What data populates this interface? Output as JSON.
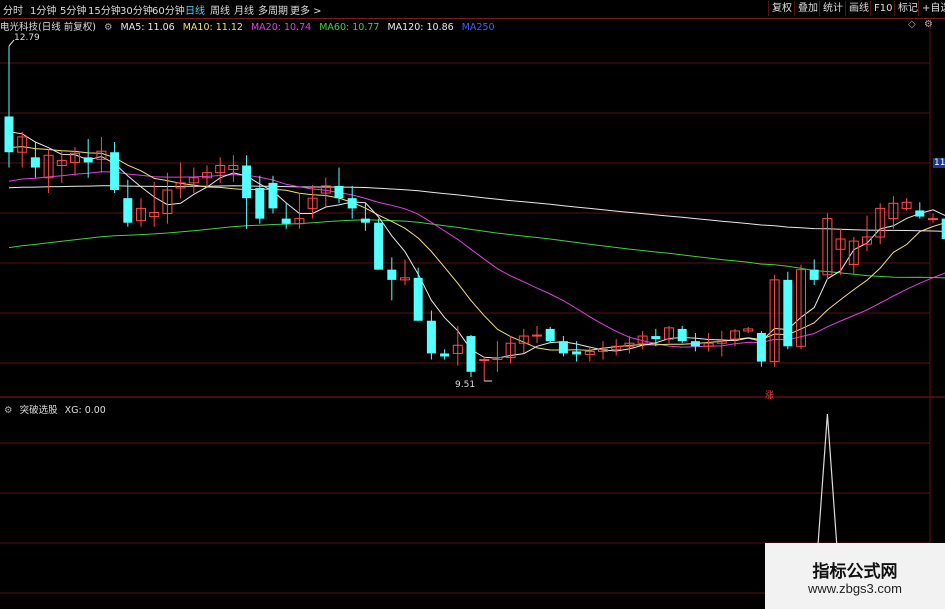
{
  "toolbar": {
    "timeframes": [
      "分时",
      "1分钟",
      "5分钟",
      "15分钟",
      "30分钟",
      "60分钟",
      "日线",
      "周线",
      "月线",
      "多周期",
      "更多 >"
    ],
    "active": "日线",
    "buttons": [
      "复权",
      "叠加",
      "统计",
      "画线",
      "F10",
      "标记",
      "+自选"
    ]
  },
  "info": {
    "title": "电光科技(日线 前复权)",
    "ma": [
      {
        "label": "MA5: 11.06",
        "color": "#e8e8e8"
      },
      {
        "label": "MA10: 11.12",
        "color": "#f0e070"
      },
      {
        "label": "MA20: 10.74",
        "color": "#e040e0"
      },
      {
        "label": "MA60: 10.77",
        "color": "#40d040"
      },
      {
        "label": "MA120: 10.86",
        "color": "#e8e8e8"
      },
      {
        "label": "MA250",
        "color": "#4060ff"
      }
    ]
  },
  "annotations": {
    "high": "12.79",
    "low": "9.51",
    "right_axis": "11",
    "zhang": "涨"
  },
  "indicator": {
    "name": "突破选股",
    "value": "XG: 0.00"
  },
  "watermark": {
    "title": "指标公式网",
    "url": "www.zbgs3.com"
  },
  "colors": {
    "up": "#ff4a4a",
    "down": "#54ffff",
    "grid": "#5a0f0f",
    "ma5": "#e8e8e8",
    "ma10": "#f0e070",
    "ma20": "#e040e0",
    "ma60": "#40d040",
    "ma120": "#e8e8e8"
  },
  "chart_data": {
    "type": "candlestick",
    "price_range": [
      9.51,
      12.79
    ],
    "candles": [
      [
        12.1,
        12.79,
        11.6,
        11.75
      ],
      [
        11.75,
        11.95,
        11.6,
        11.9
      ],
      [
        11.7,
        11.85,
        11.5,
        11.6
      ],
      [
        11.5,
        11.78,
        11.35,
        11.72
      ],
      [
        11.62,
        11.76,
        11.45,
        11.67
      ],
      [
        11.65,
        11.8,
        11.52,
        11.74
      ],
      [
        11.7,
        11.88,
        11.5,
        11.65
      ],
      [
        11.68,
        11.9,
        11.55,
        11.76
      ],
      [
        11.75,
        11.85,
        11.35,
        11.38
      ],
      [
        11.3,
        11.48,
        11.02,
        11.06
      ],
      [
        11.08,
        11.3,
        11.02,
        11.2
      ],
      [
        11.12,
        11.46,
        11.02,
        11.16
      ],
      [
        11.15,
        11.55,
        11.05,
        11.38
      ],
      [
        11.4,
        11.65,
        11.3,
        11.45
      ],
      [
        11.45,
        11.6,
        11.35,
        11.5
      ],
      [
        11.5,
        11.62,
        11.4,
        11.55
      ],
      [
        11.55,
        11.7,
        11.45,
        11.62
      ],
      [
        11.58,
        11.72,
        11.46,
        11.62
      ],
      [
        11.62,
        11.72,
        11.0,
        11.3
      ],
      [
        11.4,
        11.52,
        11.05,
        11.1
      ],
      [
        11.45,
        11.52,
        11.15,
        11.2
      ],
      [
        11.1,
        11.25,
        11.0,
        11.05
      ],
      [
        11.05,
        11.35,
        11.0,
        11.1
      ],
      [
        11.2,
        11.43,
        11.1,
        11.3
      ],
      [
        11.35,
        11.5,
        11.22,
        11.42
      ],
      [
        11.42,
        11.6,
        11.25,
        11.3
      ],
      [
        11.3,
        11.42,
        11.1,
        11.2
      ],
      [
        11.1,
        11.25,
        10.98,
        11.06
      ],
      [
        11.06,
        11.1,
        10.6,
        10.6
      ],
      [
        10.6,
        10.72,
        10.3,
        10.5
      ],
      [
        10.5,
        10.7,
        10.45,
        10.52
      ],
      [
        10.52,
        10.62,
        10.1,
        10.1
      ],
      [
        10.1,
        10.2,
        9.72,
        9.78
      ],
      [
        9.78,
        9.82,
        9.72,
        9.75
      ],
      [
        9.78,
        10.05,
        9.66,
        9.86
      ],
      [
        9.95,
        9.96,
        9.55,
        9.6
      ],
      [
        9.72,
        9.75,
        9.51,
        9.72
      ],
      [
        9.72,
        9.9,
        9.6,
        9.74
      ],
      [
        9.74,
        9.95,
        9.68,
        9.88
      ],
      [
        9.88,
        10.02,
        9.78,
        9.95
      ],
      [
        9.95,
        10.05,
        9.88,
        9.96
      ],
      [
        10.02,
        10.04,
        9.88,
        9.9
      ],
      [
        9.9,
        9.95,
        9.75,
        9.78
      ],
      [
        9.8,
        9.9,
        9.7,
        9.77
      ],
      [
        9.77,
        9.85,
        9.7,
        9.8
      ],
      [
        9.8,
        9.9,
        9.72,
        9.82
      ],
      [
        9.82,
        9.92,
        9.76,
        9.85
      ],
      [
        9.85,
        9.95,
        9.78,
        9.88
      ],
      [
        9.88,
        10.0,
        9.82,
        9.95
      ],
      [
        9.95,
        10.02,
        9.85,
        9.92
      ],
      [
        9.92,
        10.05,
        9.88,
        10.03
      ],
      [
        10.02,
        10.05,
        9.88,
        9.9
      ],
      [
        9.9,
        9.98,
        9.8,
        9.85
      ],
      [
        9.85,
        9.98,
        9.8,
        9.88
      ],
      [
        9.88,
        10.0,
        9.75,
        9.9
      ],
      [
        9.92,
        10.02,
        9.85,
        10.0
      ],
      [
        10.0,
        10.04,
        9.98,
        10.02
      ],
      [
        9.98,
        10.0,
        9.65,
        9.7
      ],
      [
        9.7,
        10.55,
        9.65,
        10.5
      ],
      [
        10.5,
        10.58,
        9.82,
        9.85
      ],
      [
        9.85,
        10.65,
        9.82,
        10.6
      ],
      [
        10.6,
        10.7,
        10.45,
        10.5
      ],
      [
        10.55,
        11.15,
        10.5,
        11.1
      ],
      [
        10.8,
        11.0,
        10.55,
        10.9
      ],
      [
        10.65,
        10.92,
        10.56,
        10.88
      ],
      [
        10.85,
        11.13,
        10.78,
        10.92
      ],
      [
        10.92,
        11.25,
        10.85,
        11.2
      ],
      [
        11.1,
        11.32,
        11.0,
        11.25
      ],
      [
        11.2,
        11.3,
        11.18,
        11.26
      ],
      [
        11.18,
        11.26,
        11.1,
        11.12
      ],
      [
        11.1,
        11.15,
        11.06,
        11.1
      ],
      [
        11.1,
        11.12,
        10.85,
        10.9
      ],
      [
        10.9,
        11.0,
        10.8,
        10.95
      ]
    ],
    "xg_signal_index": 62
  }
}
